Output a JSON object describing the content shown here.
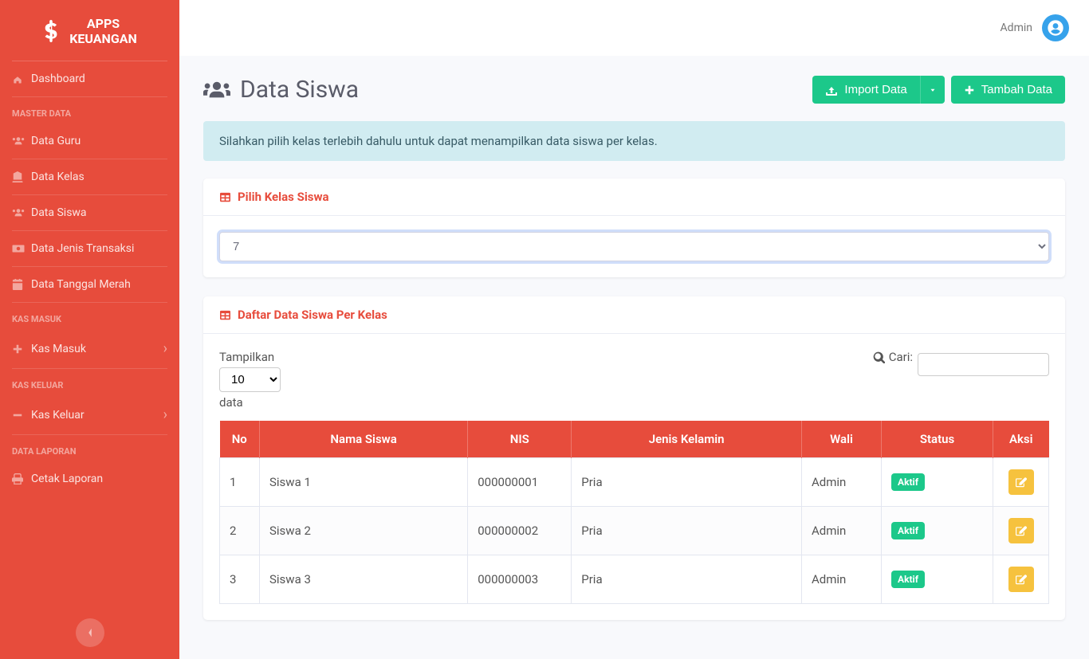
{
  "brand": {
    "title_line1": "APPS",
    "title_line2": "KEUANGAN"
  },
  "sidebar": {
    "dashboard": "Dashboard",
    "heading_master": "MASTER DATA",
    "items_master": [
      {
        "label": "Data Guru"
      },
      {
        "label": "Data Kelas"
      },
      {
        "label": "Data Siswa"
      },
      {
        "label": "Data Jenis Transaksi"
      },
      {
        "label": "Data Tanggal Merah"
      }
    ],
    "heading_kas_masuk": "KAS MASUK",
    "kas_masuk": "Kas Masuk",
    "heading_kas_keluar": "KAS KELUAR",
    "kas_keluar": "Kas Keluar",
    "heading_laporan": "DATA LAPORAN",
    "cetak_laporan": "Cetak Laporan"
  },
  "topbar": {
    "username": "Admin"
  },
  "page": {
    "title": "Data Siswa",
    "import_btn": "Import Data",
    "tambah_btn": "Tambah Data",
    "alert": "Silahkan pilih kelas terlebih dahulu untuk dapat menampilkan data siswa per kelas."
  },
  "card_select": {
    "title": "Pilih Kelas Siswa",
    "value": "7"
  },
  "card_table": {
    "title": "Daftar Data Siswa Per Kelas",
    "length_label_pre": "Tampilkan",
    "length_value": "10",
    "length_label_post": "data",
    "search_label": "Cari:",
    "columns": [
      "No",
      "Nama Siswa",
      "NIS",
      "Jenis Kelamin",
      "Wali",
      "Status",
      "Aksi"
    ],
    "rows": [
      {
        "no": "1",
        "nama": "Siswa 1",
        "nis": "000000001",
        "jk": "Pria",
        "wali": "Admin",
        "status": "Aktif"
      },
      {
        "no": "2",
        "nama": "Siswa 2",
        "nis": "000000002",
        "jk": "Pria",
        "wali": "Admin",
        "status": "Aktif"
      },
      {
        "no": "3",
        "nama": "Siswa 3",
        "nis": "000000003",
        "jk": "Pria",
        "wali": "Admin",
        "status": "Aktif"
      }
    ]
  }
}
